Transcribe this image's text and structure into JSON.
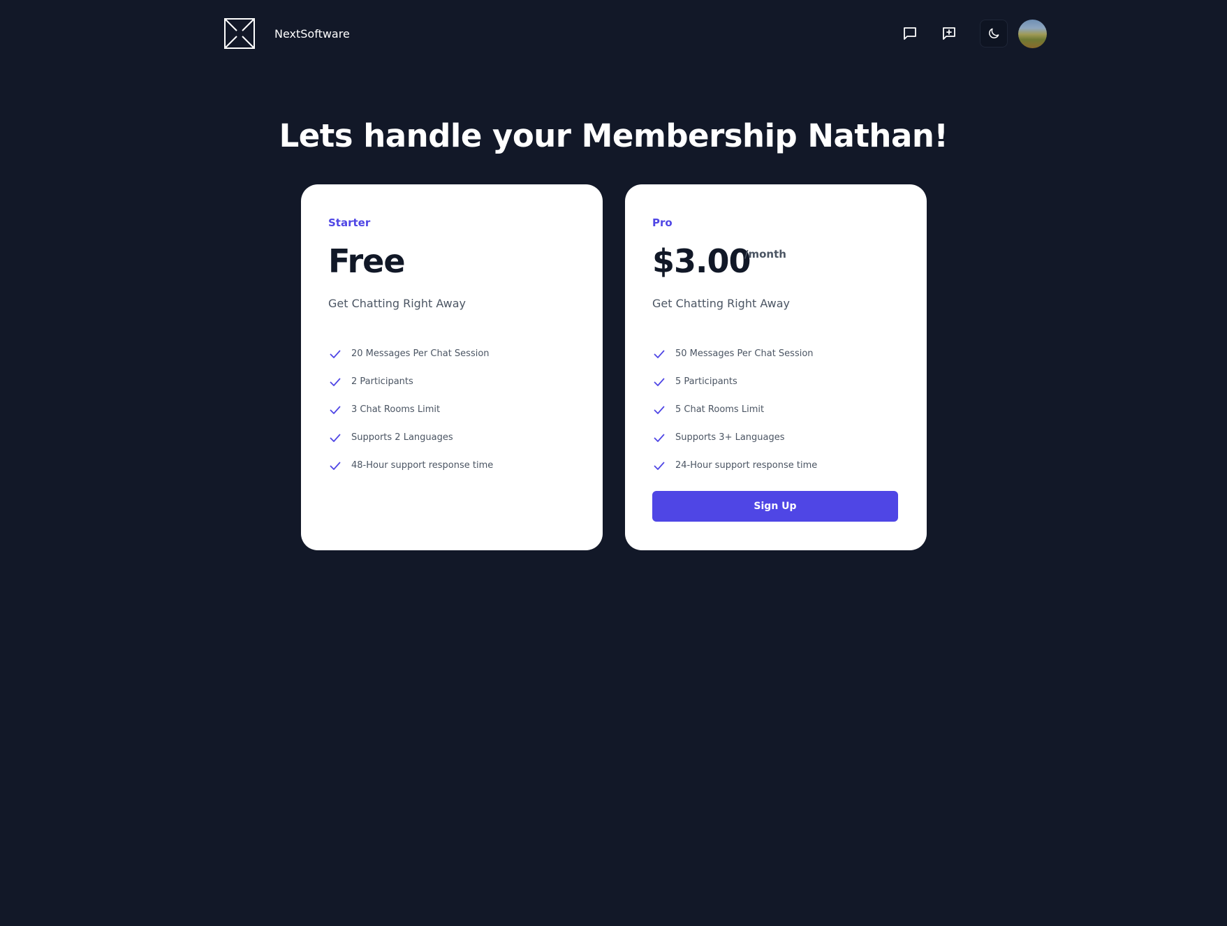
{
  "header": {
    "brand": "NextSoftware",
    "logo_icon": "logo-mark-icon",
    "icons": {
      "chat": "message-square-icon",
      "new_chat": "message-square-plus-icon",
      "theme": "moon-icon"
    }
  },
  "title": "Lets handle your Membership Nathan!",
  "plans": {
    "starter": {
      "tier": "Starter",
      "price": "Free",
      "tagline": "Get Chatting Right Away",
      "features": [
        "20 Messages Per Chat Session",
        "2 Participants",
        "3 Chat Rooms Limit",
        "Supports 2 Languages",
        "48-Hour support response time"
      ]
    },
    "pro": {
      "tier": "Pro",
      "price": "$3.00",
      "period": "/month",
      "tagline": "Get Chatting Right Away",
      "features": [
        "50 Messages Per Chat Session",
        "5 Participants",
        "5 Chat Rooms Limit",
        "Supports 3+ Languages",
        "24-Hour support response time"
      ],
      "cta": "Sign Up"
    }
  },
  "colors": {
    "background": "#121828",
    "accent": "#4f46e5",
    "card": "#ffffff",
    "heading": "#111827",
    "text": "#4b5563"
  }
}
